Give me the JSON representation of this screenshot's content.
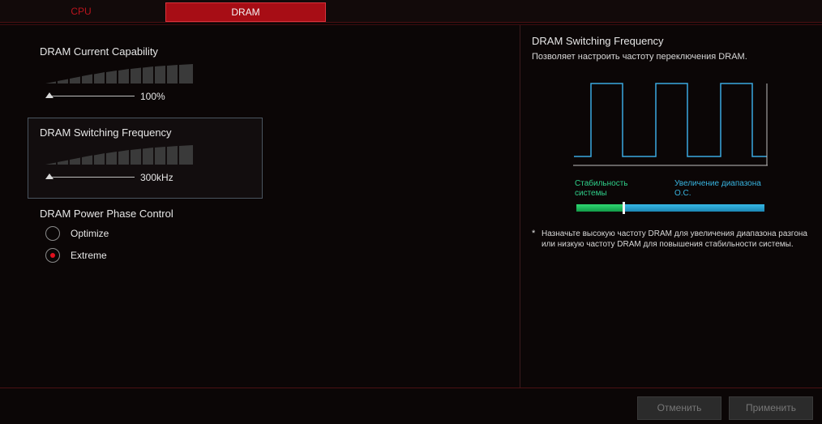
{
  "tabs": [
    {
      "label": "CPU",
      "active": false
    },
    {
      "label": "DRAM",
      "active": true
    }
  ],
  "settings": {
    "current_capability": {
      "label": "DRAM Current Capability",
      "value": "100%",
      "level": 1.0
    },
    "switching_frequency": {
      "label": "DRAM Switching Frequency",
      "value": "300kHz",
      "level": 1.0
    },
    "power_phase": {
      "label": "DRAM Power Phase Control",
      "options": [
        {
          "label": "Optimize",
          "selected": false
        },
        {
          "label": "Extreme",
          "selected": true
        }
      ]
    }
  },
  "help": {
    "title": "DRAM Switching Frequency",
    "description": "Позволяет настроить частоту переключения DRAM.",
    "stability_label": "Стабильность системы",
    "oc_range_label": "Увеличение диапазона О.С.",
    "note_marker": "*",
    "note": "Назначьте высокую частоту DRAM для увеличения  диапазона разгона или низкую частоту DRAM для повышения стабильности системы."
  },
  "buttons": {
    "cancel": "Отменить",
    "apply": "Применить"
  },
  "colors": {
    "accent_red": "#a70d15",
    "radio_selected": "#e0101e",
    "stability_green": "#2fd08a",
    "oc_blue": "#38b4e0",
    "waveform": "#3aa8e0"
  }
}
